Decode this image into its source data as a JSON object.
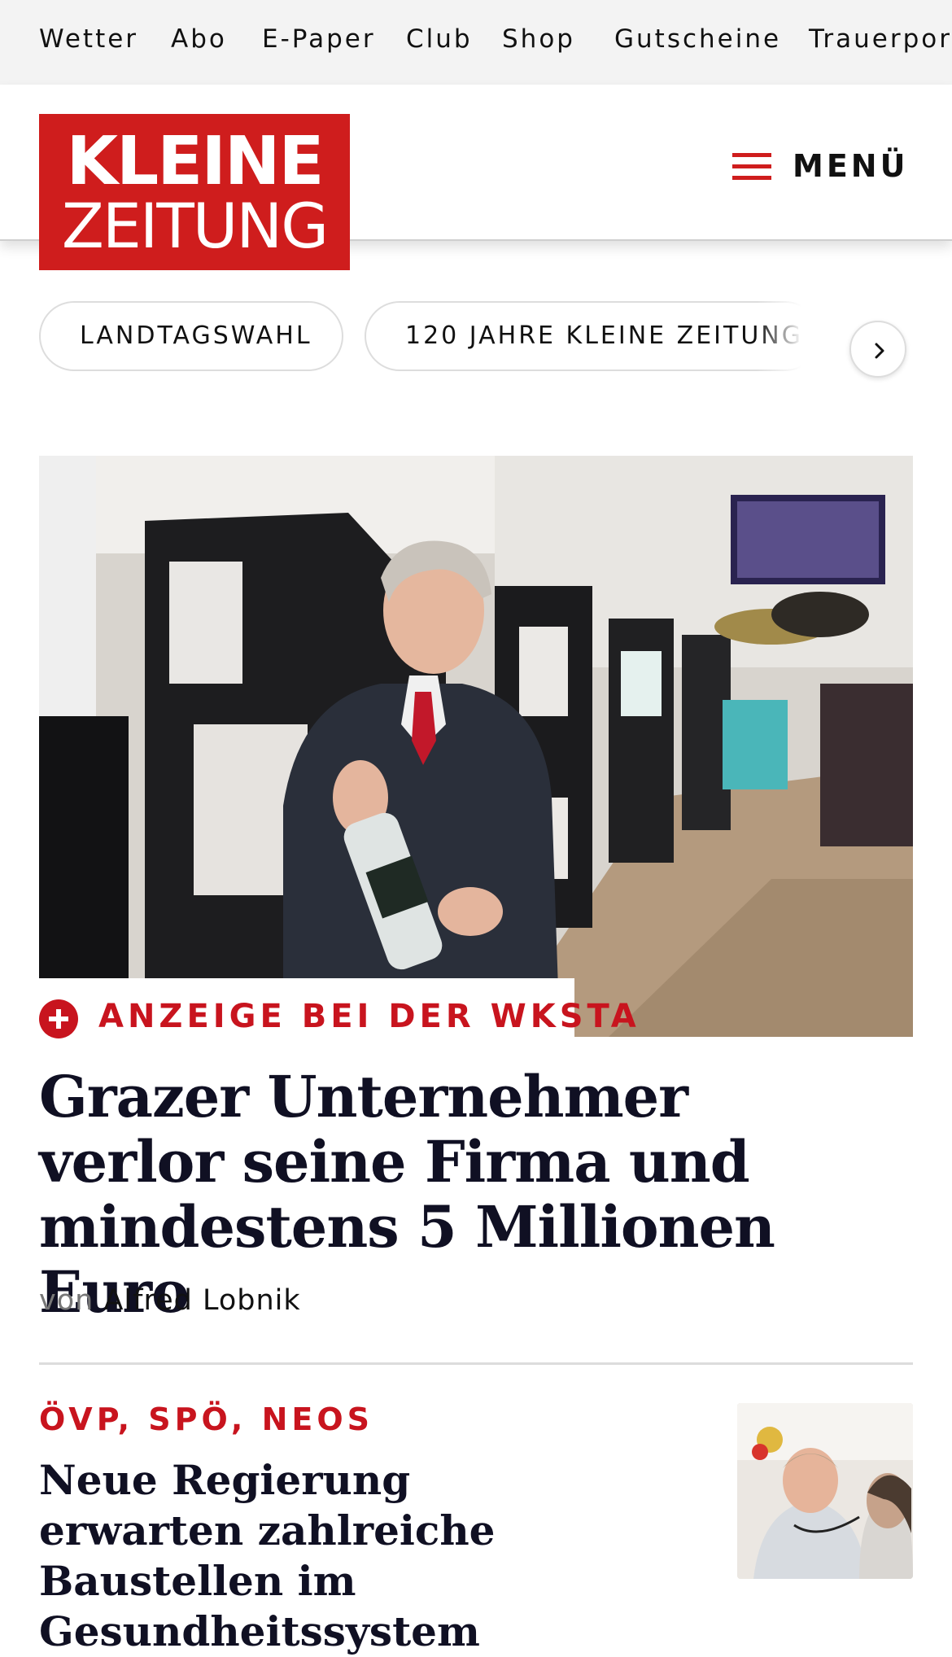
{
  "topnav": {
    "items": [
      "Wetter",
      "Abo",
      "E-Paper",
      "Club",
      "Shop",
      "Gutscheine",
      "Trauerportal"
    ]
  },
  "header": {
    "logo_line1": "KLEINE",
    "logo_line2": "ZEITUNG",
    "menu_label": "MENÜ"
  },
  "tags": [
    "LANDTAGSWAHL",
    "120 JAHRE KLEINE ZEITUNG"
  ],
  "lead_article": {
    "kicker": "ANZEIGE BEI DER WKSTA",
    "headline": "Grazer Unternehmer verlor seine Firma und mindestens 5 Millionen Euro",
    "byline_prefix": "von",
    "author": "Alfred Lobnik"
  },
  "second_article": {
    "kicker": "ÖVP, SPÖ, NEOS",
    "headline": "Neue Regierung erwarten zahlreiche Baustellen im Gesundheitssystem"
  },
  "colors": {
    "brand_red": "#cf1d1d",
    "kicker_red": "#c8141e",
    "headline": "#101023",
    "nav_bg": "#f3f3f3"
  },
  "icons": {
    "menu": "hamburger-icon",
    "tag_next": "chevron-right-icon",
    "kicker": "plus-circle-icon"
  }
}
